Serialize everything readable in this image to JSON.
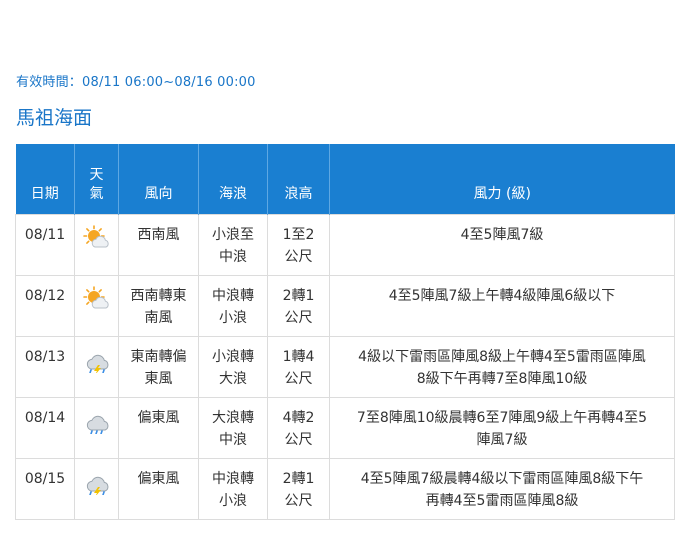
{
  "validity": "有效時間：08/11 06:00~08/16 00:00",
  "area_title": "馬祖海面",
  "table": {
    "headers": {
      "date": "日期",
      "weather_line1": "天",
      "weather_line2": "氣",
      "wind_dir": "風向",
      "wave": "海浪",
      "wave_height": "浪高",
      "wind_force": "風力 (級)"
    },
    "rows": [
      {
        "date": "08/11",
        "weather_icon": "sun-cloud-icon",
        "wind_dir_1": "西南風",
        "wind_dir_2": "",
        "wave_1": "小浪至",
        "wave_2": "中浪",
        "height_1": "1至2",
        "height_2": "公尺",
        "force_1": "4至5陣風7級",
        "force_2": ""
      },
      {
        "date": "08/12",
        "weather_icon": "sun-cloud-icon",
        "wind_dir_1": "西南轉東",
        "wind_dir_2": "南風",
        "wave_1": "中浪轉",
        "wave_2": "小浪",
        "height_1": "2轉1",
        "height_2": "公尺",
        "force_1": "4至5陣風7級上午轉4級陣風6級以下",
        "force_2": ""
      },
      {
        "date": "08/13",
        "weather_icon": "thunderstorm-icon",
        "wind_dir_1": "東南轉偏",
        "wind_dir_2": "東風",
        "wave_1": "小浪轉",
        "wave_2": "大浪",
        "height_1": "1轉4",
        "height_2": "公尺",
        "force_1": "4級以下雷雨區陣風8級上午轉4至5雷雨區陣風",
        "force_2": "8級下午再轉7至8陣風10級"
      },
      {
        "date": "08/14",
        "weather_icon": "rain-cloud-icon",
        "wind_dir_1": "偏東風",
        "wind_dir_2": "",
        "wave_1": "大浪轉",
        "wave_2": "中浪",
        "height_1": "4轉2",
        "height_2": "公尺",
        "force_1": "7至8陣風10級晨轉6至7陣風9級上午再轉4至5",
        "force_2": "陣風7級"
      },
      {
        "date": "08/15",
        "weather_icon": "thunderstorm-icon",
        "wind_dir_1": "偏東風",
        "wind_dir_2": "",
        "wave_1": "中浪轉",
        "wave_2": "小浪",
        "height_1": "2轉1",
        "height_2": "公尺",
        "force_1": "4至5陣風7級晨轉4級以下雷雨區陣風8級下午",
        "force_2": "再轉4至5雷雨區陣風8級"
      }
    ]
  },
  "colors": {
    "accent": "#1a76c8",
    "header_bg": "#1a7fd1",
    "border": "#dcdcdc",
    "sun": "#f5a623",
    "rain": "#3a8ee6",
    "lightning": "#f2c200"
  }
}
